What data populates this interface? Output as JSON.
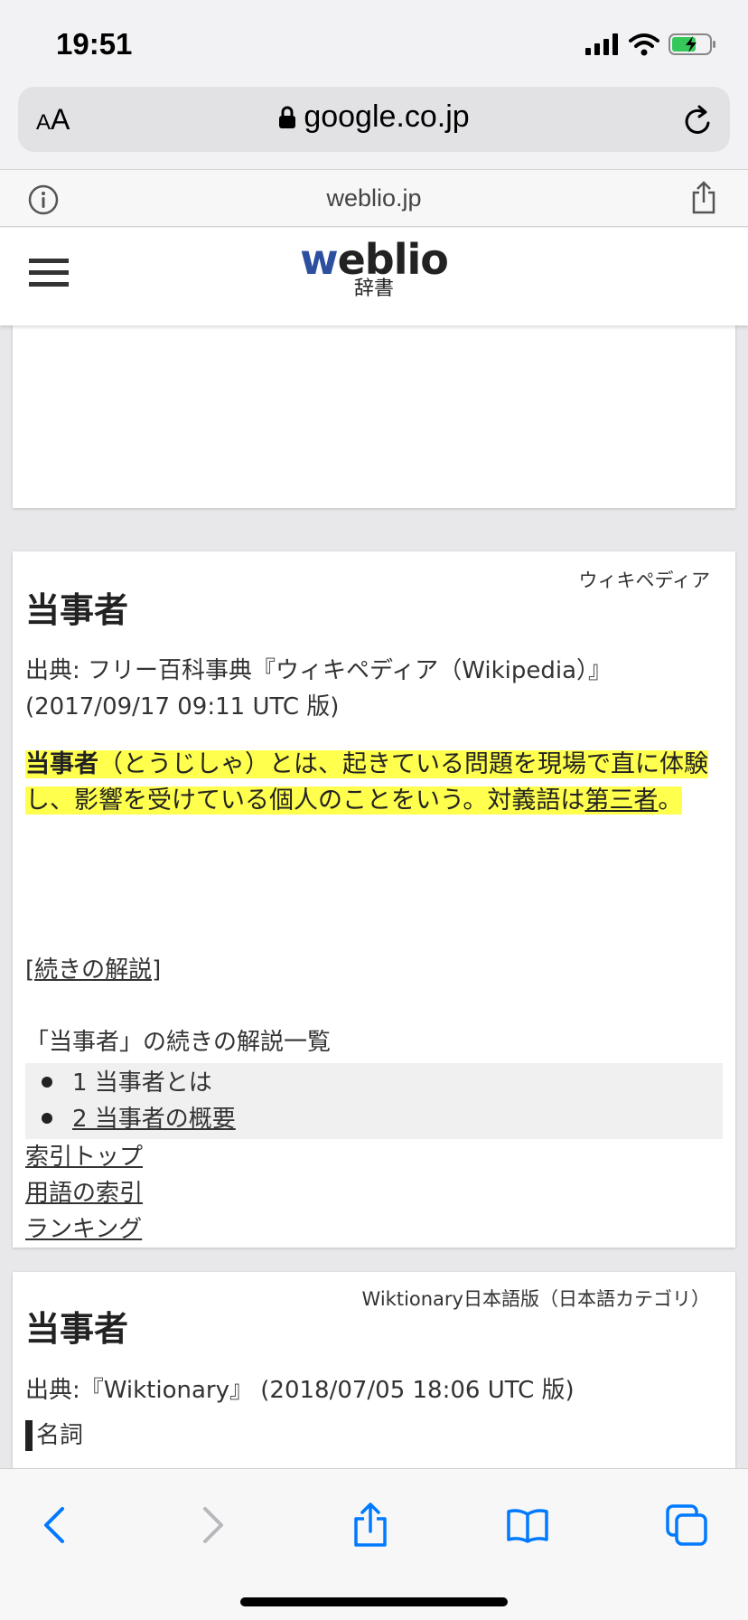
{
  "status": {
    "time": "19:51"
  },
  "address": {
    "aa_small": "A",
    "aa_big": "A",
    "url": "google.co.jp"
  },
  "site": {
    "domain": "weblio.jp"
  },
  "header": {
    "logo_w": "w",
    "logo_rest": "eblio",
    "logo_sub": "辞書"
  },
  "wiki": {
    "source_label": "ウィキペディア",
    "title": "当事者",
    "source_line": "出典: フリー百科事典『ウィキペディア（Wikipedia）』(2017/09/17 09:11 UTC 版)",
    "def_term": "当事者",
    "def_text": "（とうじしゃ）とは、起きている問題を現場で直に体験し、影響を受けている個人のことをいう。対義語は",
    "def_link": "第三者",
    "def_end": "。",
    "more_link": "[続きの解説]",
    "list_heading": "「当事者」の続きの解説一覧",
    "toc": [
      {
        "label": "1 当事者とは",
        "linked": false
      },
      {
        "label": "2 当事者の概要",
        "linked": true
      }
    ],
    "nav_links": [
      "索引トップ",
      "用語の索引",
      "ランキング"
    ]
  },
  "wiktionary": {
    "source_label": "Wiktionary日本語版（日本語カテゴリ）",
    "title": "当事者",
    "source_line": "出典:『Wiktionary』 (2018/07/05 18:06 UTC 版)",
    "pos": "名詞"
  },
  "toolbar": {
    "back_icon": "chevron-left-icon",
    "forward_icon": "chevron-right-icon",
    "share_icon": "share-icon",
    "bookmarks_icon": "book-icon",
    "tabs_icon": "tabs-icon"
  },
  "colors": {
    "accent": "#007aff",
    "highlight": "#ffff4d",
    "logo_blue": "#2c4fa0"
  }
}
